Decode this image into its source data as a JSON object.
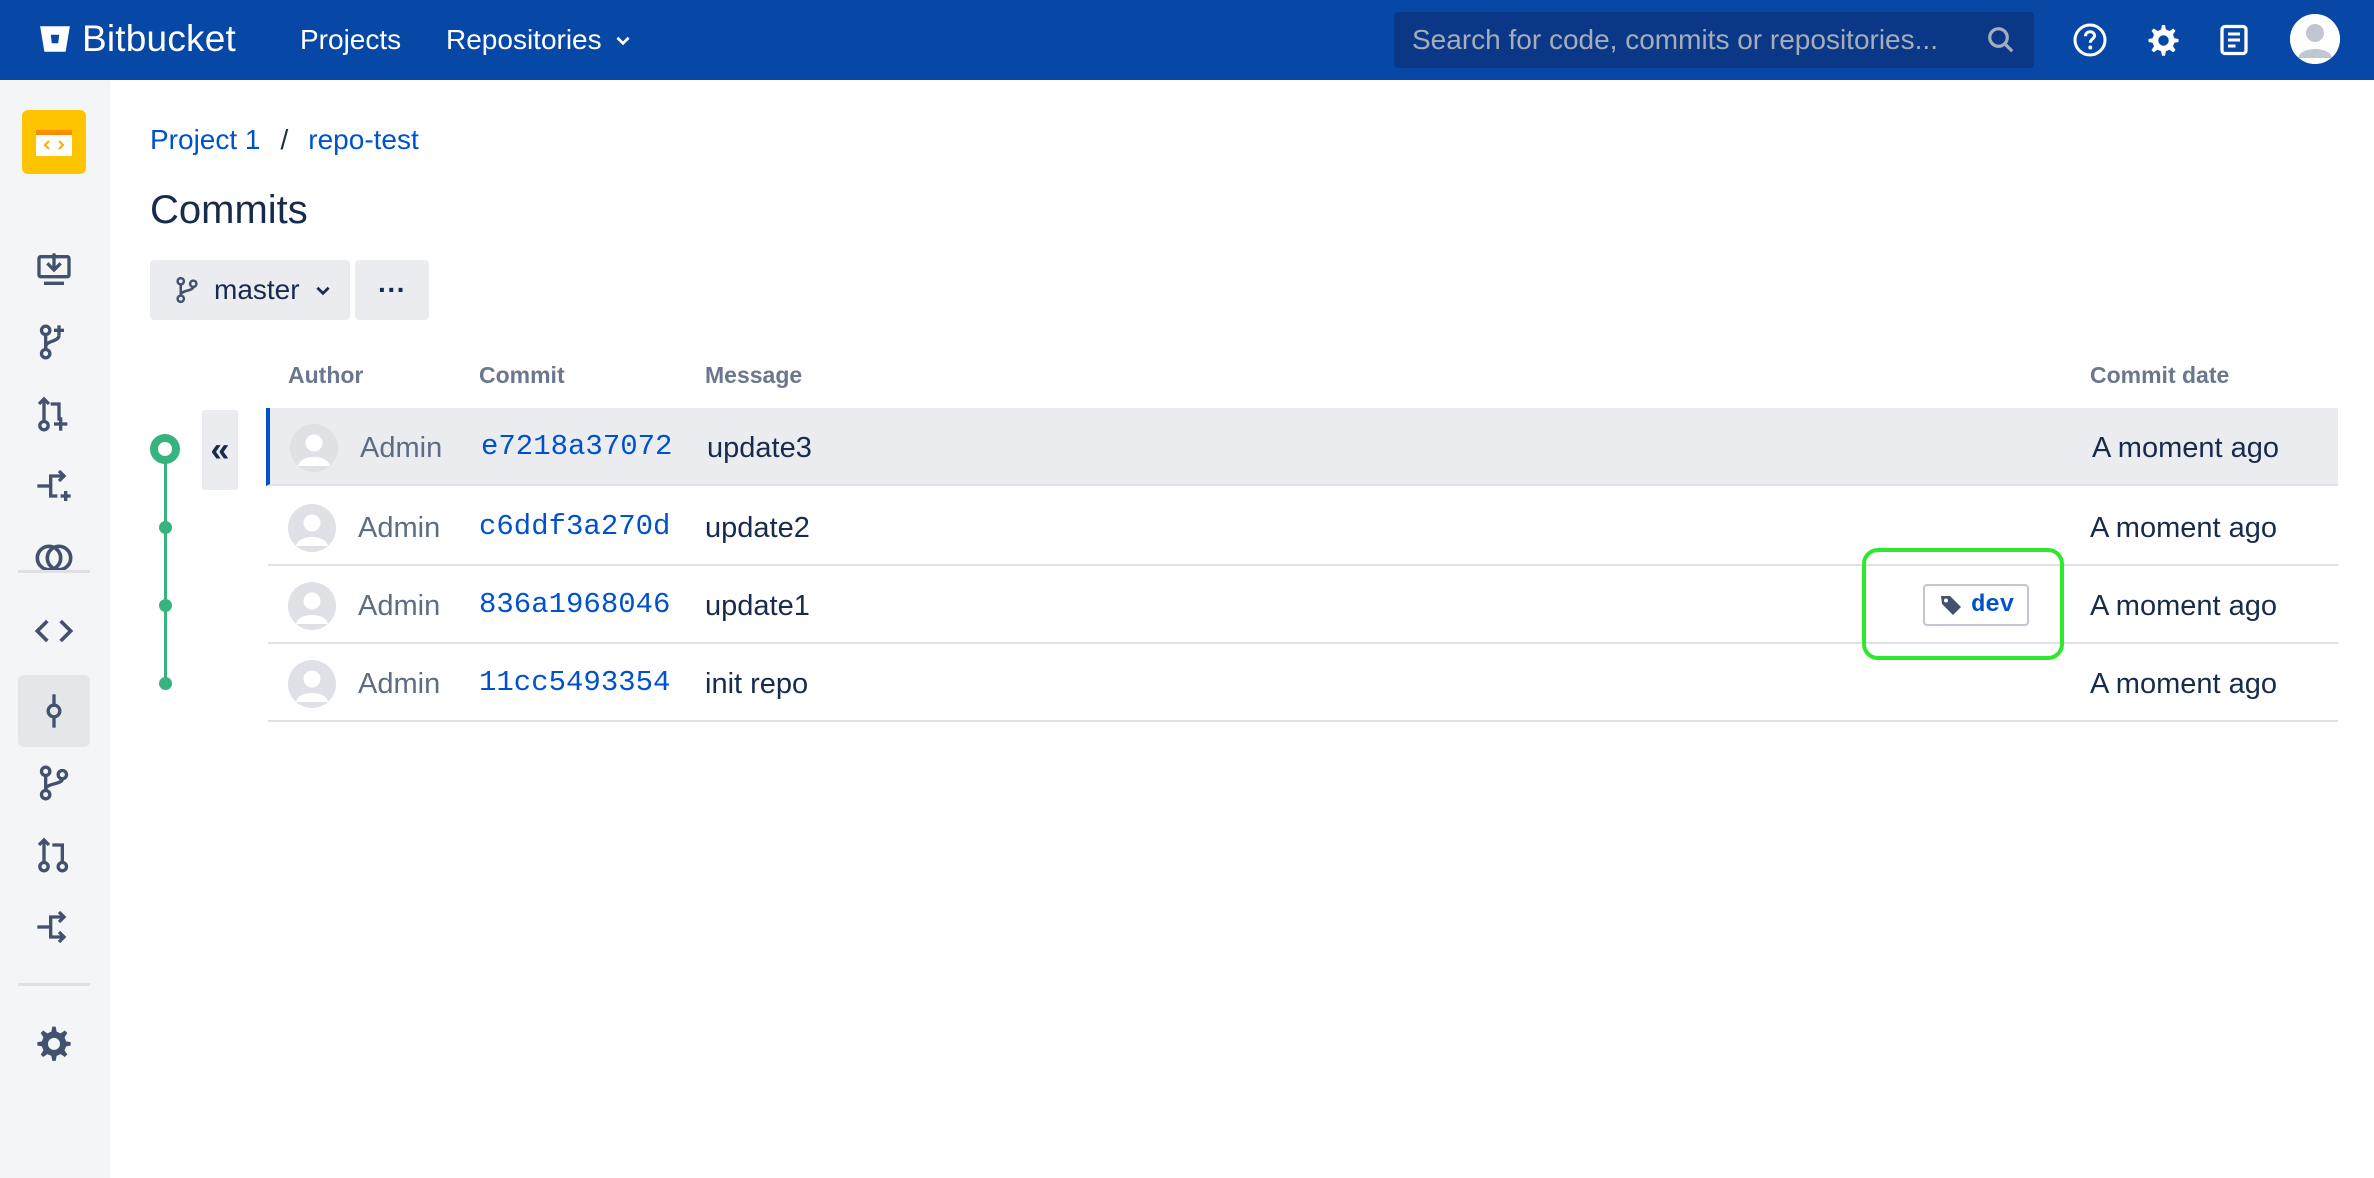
{
  "header": {
    "logo_text": "Bitbucket",
    "nav": [
      {
        "label": "Projects"
      },
      {
        "label": "Repositories"
      }
    ],
    "search_placeholder": "Search for code, commits or repositories...",
    "icons": [
      "help-icon",
      "gear-icon",
      "notes-icon",
      "user-avatar"
    ]
  },
  "sidebar": {
    "project_icon": "project-avatar",
    "items": [
      "clone-icon",
      "create-branch-icon",
      "create-pull-request-icon",
      "fork-icon",
      "compare-icon",
      "source-icon",
      "commits-icon",
      "branches-icon",
      "pull-requests-icon",
      "forks-icon",
      "settings-icon"
    ],
    "active": "commits-icon"
  },
  "breadcrumb": {
    "project": "Project 1",
    "separator": "/",
    "repo": "repo-test"
  },
  "page": {
    "title": "Commits"
  },
  "toolbar": {
    "branch": "master",
    "more": "···"
  },
  "table": {
    "headers": {
      "author": "Author",
      "commit": "Commit",
      "message": "Message",
      "date": "Commit date"
    },
    "collapse_label": "«",
    "rows": [
      {
        "author": "Admin",
        "commit": "e7218a37072",
        "message": "update3",
        "date": "A moment ago"
      },
      {
        "author": "Admin",
        "commit": "c6ddf3a270d",
        "message": "update2",
        "date": "A moment ago"
      },
      {
        "author": "Admin",
        "commit": "836a1968046",
        "message": "update1",
        "date": "A moment ago",
        "tag": "dev"
      },
      {
        "author": "Admin",
        "commit": "11cc5493354",
        "message": "init repo",
        "date": "A moment ago"
      }
    ]
  },
  "colors": {
    "header_bg": "#0747a6",
    "link": "#0052cc",
    "graph": "#36b37e",
    "highlight": "#2ee82e"
  }
}
